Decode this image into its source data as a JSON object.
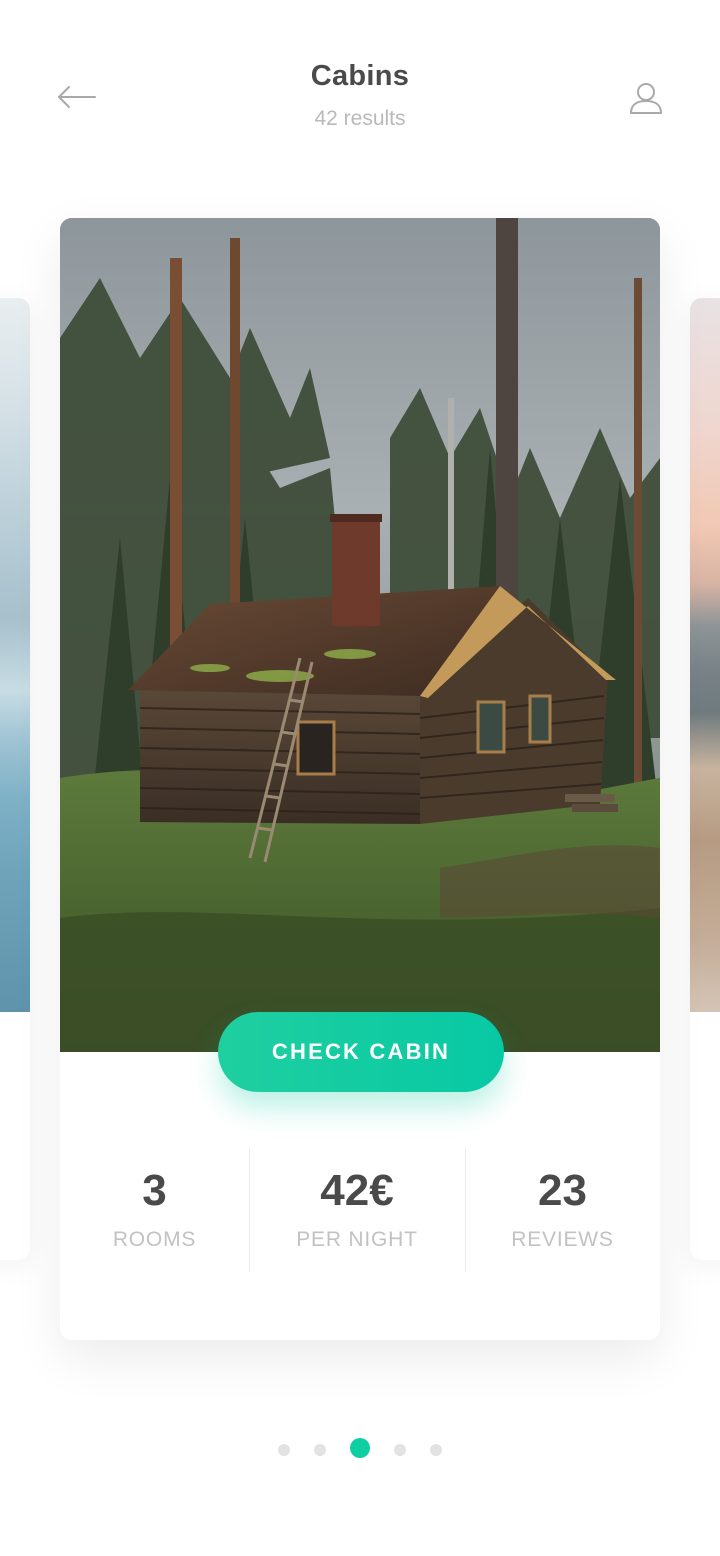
{
  "header": {
    "title": "Cabins",
    "subtitle": "42 results",
    "back_icon": "arrow-left-icon",
    "profile_icon": "user-icon"
  },
  "card": {
    "image_subject": "log cabin in pine forest",
    "cta_label": "CHECK CABIN",
    "stats": [
      {
        "value": "3",
        "label": "ROOMS"
      },
      {
        "value": "42€",
        "label": "PER NIGHT"
      },
      {
        "value": "23",
        "label": "REVIEWS"
      }
    ]
  },
  "pagination": {
    "total": 5,
    "active_index": 2
  },
  "colors": {
    "accent": "#0fcfa2",
    "title_text": "#4a4a4a",
    "muted_text": "#b9b9b9",
    "dot_inactive": "#e3e3e3"
  }
}
